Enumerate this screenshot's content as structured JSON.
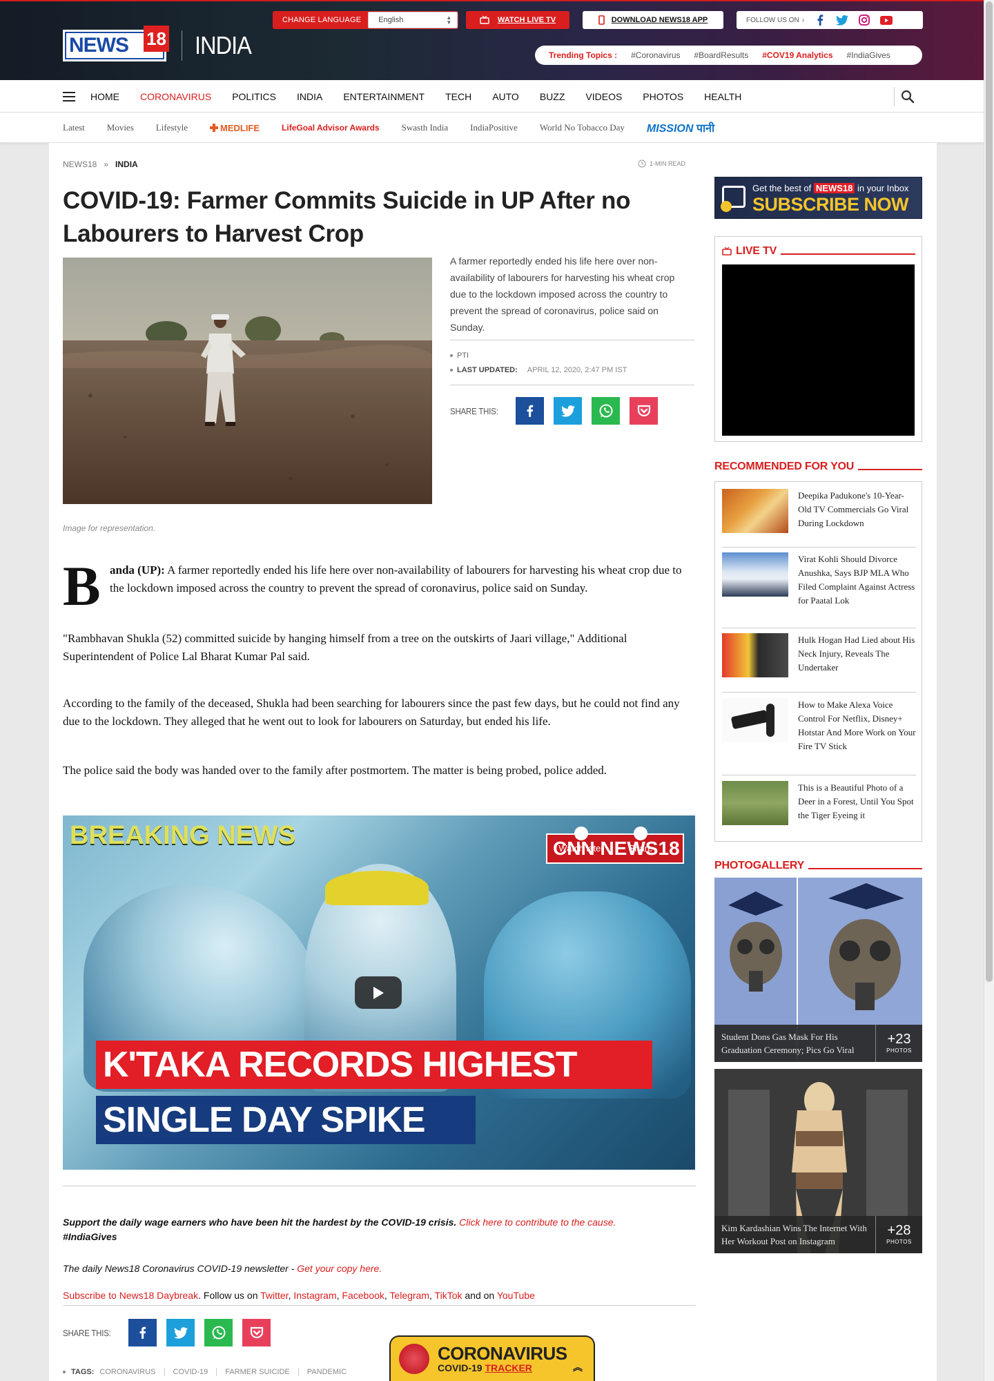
{
  "header": {
    "logo_text": "NEWS",
    "logo_num": "18",
    "section": "INDIA",
    "change_language_label": "CHANGE LANGUAGE",
    "language_value": "English",
    "watch_live_label": "WATCH LIVE TV",
    "download_app_label": "DOWNLOAD NEWS18 APP",
    "follow_label": "FOLLOW US ON",
    "social_icons": [
      "facebook-icon",
      "twitter-icon",
      "instagram-icon",
      "youtube-icon"
    ],
    "trending_label": "Trending Topics :",
    "trending": [
      "#Coronavirus",
      "#BoardResults",
      "#COV19 Analytics",
      "#IndiaGives"
    ]
  },
  "nav": {
    "items": [
      "HOME",
      "CORONAVIRUS",
      "POLITICS",
      "INDIA",
      "ENTERTAINMENT",
      "TECH",
      "AUTO",
      "BUZZ",
      "VIDEOS",
      "PHOTOS",
      "HEALTH"
    ],
    "active_index": 1
  },
  "subnav": {
    "items": [
      "Latest",
      "Movies",
      "Lifestyle"
    ],
    "medlife": "MEDLIFE",
    "lifegoal": "LifeGoal Advisor Awards",
    "items2": [
      "Swasth India",
      "IndiaPositive",
      "World No Tobacco Day"
    ],
    "mission": "MISSION",
    "mission_hindi": "पानी"
  },
  "article": {
    "breadcrumb": [
      "NEWS18",
      "INDIA"
    ],
    "breadcrumb_sep": "»",
    "read_time": "1-MIN READ",
    "headline": "COVID-19: Farmer Commits Suicide in UP After no Labourers to Harvest Crop",
    "image_caption": "Image for representation.",
    "summary": "A farmer reportedly ended his life here over non-availability of labourers for harvesting his wheat crop due to the lockdown imposed across the country to prevent the spread of coronavirus, police said on Sunday.",
    "agency": "PTI",
    "last_updated_label": "LAST UPDATED:",
    "last_updated": "APRIL 12, 2020, 2:47 PM IST",
    "share_label": "SHARE THIS:",
    "drop_cap": "B",
    "dateline": "anda (UP):",
    "p1_rest": " A farmer reportedly ended his life here over non-availability of labourers for harvesting his wheat crop due to the lockdown imposed across the country to prevent the spread of coronavirus, police said on Sunday.",
    "p2": "\"Rambhavan Shukla (52) committed suicide by hanging himself from a tree on the outskirts of Jaari village,\" Additional Superintendent of Police Lal Bharat Kumar Pal said.",
    "p3": "According to the family of the deceased, Shukla had been searching for labourers since the past few days, but he could not find any due to the lockdown. They alleged that he went out to look for labourers on Saturday, but ended his life.",
    "p4": "The police said the body was handed over to the family after postmortem. The matter is being probed, police added.",
    "video": {
      "breaking": "BREAKING NEWS",
      "channel": "CNN NEWS18",
      "watch_later": "Watch later",
      "share": "Share",
      "line1": "K'TAKA RECORDS HIGHEST",
      "line2": "SINGLE DAY SPIKE"
    },
    "support_text": "Support the daily wage earners who have been hit the hardest by the COVID-19 crisis.",
    "support_link": "Click here to contribute to the cause.",
    "support_tag": "#IndiaGives",
    "newsletter_text": "The daily News18 Coronavirus COVID-19 newsletter -",
    "newsletter_link": "Get your copy here.",
    "subscribe_link": "Subscribe to News18 Daybreak",
    "follow_us_on": ". Follow us on",
    "social_links": [
      "Twitter",
      "Instagram",
      "Facebook",
      "Telegram",
      "TikTok"
    ],
    "and_on": "and on",
    "youtube": "YouTube",
    "tags_label": "TAGS:",
    "tags": [
      "CORONAVIRUS",
      "COVID-19",
      "FARMER SUICIDE",
      "PANDEMIC"
    ]
  },
  "covid_tracker": {
    "title": "CORONAVIRUS",
    "sub1": "COVID-19",
    "sub2": "TRACKER"
  },
  "sidebar": {
    "subscribe": {
      "line1_pre": "Get the best of",
      "line1_brand": "NEWS18",
      "line1_post": "in your Inbox",
      "line2": "SUBSCRIBE NOW"
    },
    "live_tv_title": "LIVE TV",
    "recommended_title": "RECOMMENDED FOR YOU",
    "recommended": [
      "Deepika Padukone's 10-Year-Old TV Commercials Go Viral During Lockdown",
      "Virat Kohli Should Divorce Anushka, Says BJP MLA Who Filed Complaint Against Actress for Paatal Lok",
      "Hulk Hogan Had Lied about His Neck Injury, Reveals The Undertaker",
      "How to Make Alexa Voice Control For Netflix, Disney+ Hotstar And More Work on Your Fire TV Stick",
      "This is a Beautiful Photo of a Deer in a Forest, Until You Spot the Tiger Eyeing it"
    ],
    "photogallery_title": "PHOTOGALLERY",
    "galleries": [
      {
        "caption": "Student Dons Gas Mask For His Graduation Ceremony; Pics Go Viral",
        "count": "+23",
        "count_label": "PHOTOS"
      },
      {
        "caption": "Kim Kardashian Wins The Internet With Her Workout Post on Instagram",
        "count": "+28",
        "count_label": "PHOTOS"
      }
    ]
  },
  "colors": {
    "brand_red": "#d91e1e",
    "brand_blue": "#1a4aa6",
    "facebook": "#1c4f9c",
    "twitter": "#1d9fdc",
    "whatsapp": "#2ab94e",
    "pocket": "#e8405b"
  }
}
